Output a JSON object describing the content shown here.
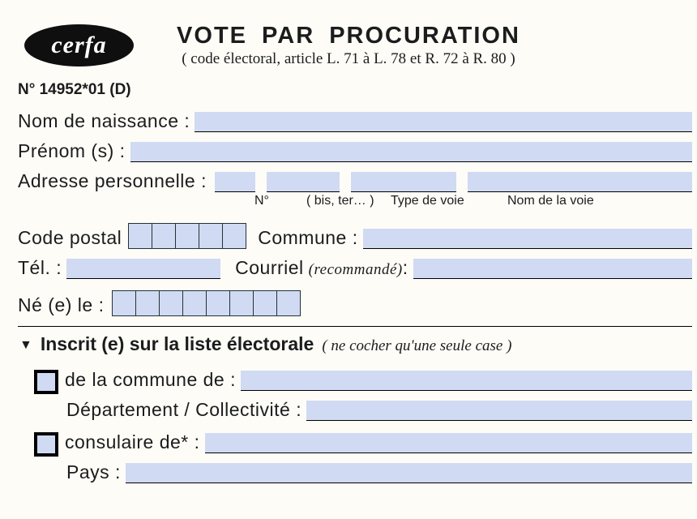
{
  "header": {
    "logo_text": "cerfa",
    "form_number": "N° 14952*01 (D)",
    "title": "VOTE  PAR  PROCURATION",
    "subtitle": "( code électoral, article L. 71 à L. 78 et R. 72 à R. 80 )"
  },
  "fields": {
    "birth_name_label": "Nom de naissance  :",
    "given_names_label": "Prénom (s) :",
    "address_label": "Adresse personnelle :",
    "address_parts": {
      "no": "N°",
      "bis": "( bis, ter… )",
      "type": "Type de voie",
      "name": "Nom de la voie"
    },
    "postal_label": "Code postal",
    "commune_label": "Commune :",
    "tel_label": "Tél. :",
    "email_label": "Courriel",
    "email_hint": "(recommandé)",
    "birth_label": "Né (e) le :"
  },
  "section": {
    "title": "Inscrit (e) sur la liste électorale",
    "hint": "( ne cocher qu'une seule case )",
    "opt_commune": "de la commune de  :",
    "opt_dept": "Département / Collectivité  :",
    "opt_consulaire": "consulaire de*  :",
    "opt_pays": "Pays :"
  }
}
